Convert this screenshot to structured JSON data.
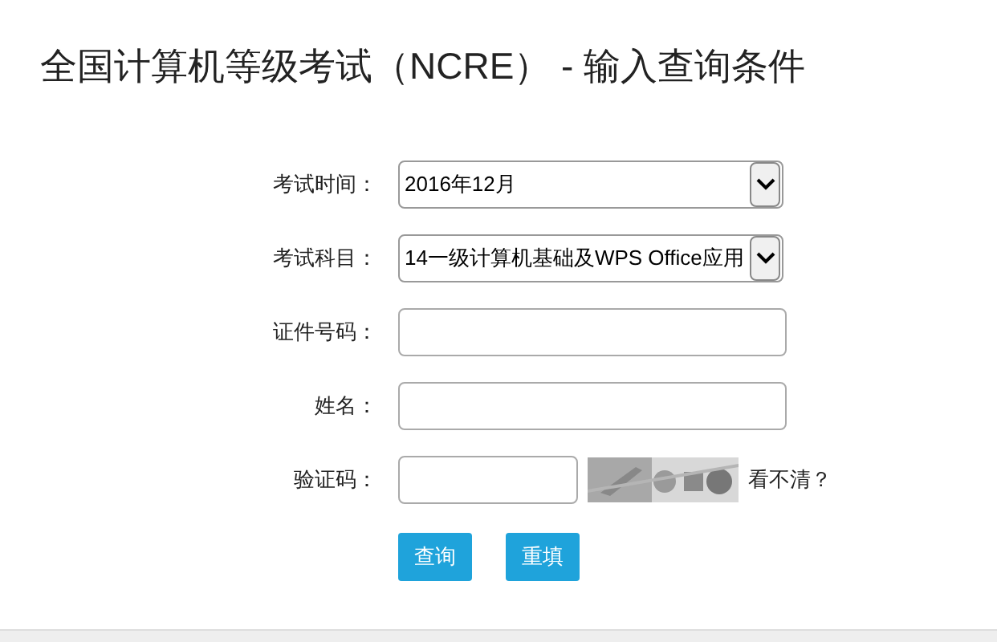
{
  "title": "全国计算机等级考试（NCRE） - 输入查询条件",
  "fields": [
    {
      "kind": "select",
      "label": "考试时间：",
      "value": "2016年12月"
    },
    {
      "kind": "select",
      "label": "考试科目：",
      "value": "14一级计算机基础及WPS Office应用"
    },
    {
      "kind": "input",
      "label": "证件号码："
    },
    {
      "kind": "input",
      "label": "姓名："
    },
    {
      "kind": "captcha",
      "label": "验证码：",
      "link": "看不清？"
    }
  ],
  "buttons": [
    "查询",
    "重填"
  ]
}
